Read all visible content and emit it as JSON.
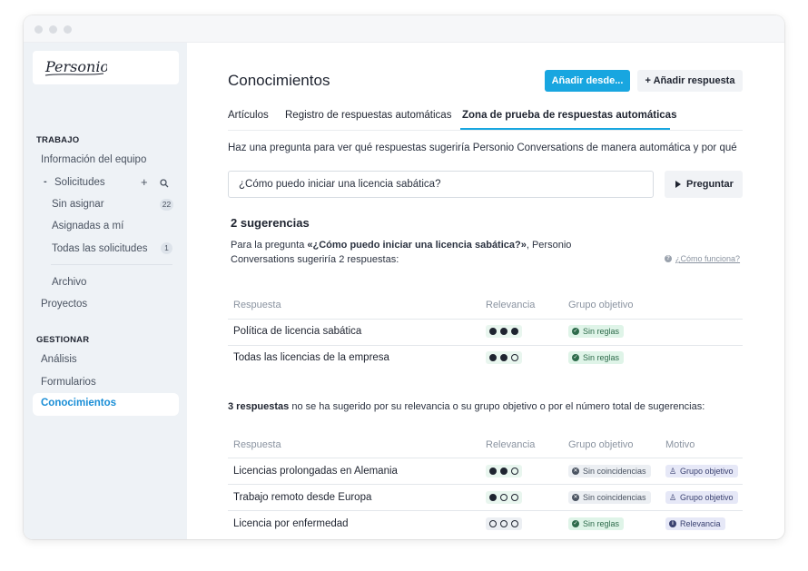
{
  "sidebar": {
    "logo_text": "Personio",
    "sections": [
      {
        "title": "TRABAJO"
      },
      {
        "title": "GESTIONAR"
      }
    ],
    "items": {
      "team_info": "Información del equipo",
      "requests": "Solicitudes",
      "unassigned": "Sin asignar",
      "unassigned_count": "22",
      "assigned_to_me": "Asignadas a mí",
      "all_requests": "Todas las solicitudes",
      "all_requests_count": "1",
      "archive": "Archivo",
      "projects": "Proyectos",
      "analysis": "Análisis",
      "forms": "Formularios",
      "knowledge": "Conocimientos"
    },
    "icons": {
      "collapse": "-",
      "add": "+",
      "search": "search-icon"
    }
  },
  "header": {
    "title": "Conocimientos",
    "add_from_label": "Añadir desde...",
    "add_answer_label": "+ Añadir respuesta"
  },
  "tabs": [
    {
      "label": "Artículos",
      "active": false
    },
    {
      "label": "Registro de respuestas automáticas",
      "active": false
    },
    {
      "label": "Zona de prueba de respuestas automáticas",
      "active": true
    }
  ],
  "playground": {
    "intro": "Haz una pregunta para ver qué respuestas sugeriría Personio Conversations de manera automática y por qué",
    "question_value": "¿Cómo puedo iniciar una licencia sabática?",
    "ask_label": "Preguntar"
  },
  "suggestions": {
    "title": "2 sugerencias",
    "desc_prefix": "Para la pregunta ",
    "desc_question": "«¿Cómo puedo iniciar una licencia sabática?»",
    "desc_suffix": ", Personio Conversations sugeriría 2 respuestas:",
    "help_link": "¿Cómo funciona?",
    "columns": {
      "answer": "Respuesta",
      "relevance": "Relevancia",
      "target_group": "Grupo objetivo"
    },
    "rows": [
      {
        "answer": "Política de licencia sabática",
        "relevance": 3,
        "target": "Sin reglas"
      },
      {
        "answer": "Todas las licencias de la empresa",
        "relevance": 2,
        "target": "Sin reglas"
      }
    ]
  },
  "not_suggested": {
    "count_bold": "3 respuestas",
    "text": " no se ha sugerido por su relevancia o su grupo objetivo o por el número total de sugerencias:",
    "columns": {
      "answer": "Respuesta",
      "relevance": "Relevancia",
      "target_group": "Grupo objetivo",
      "reason": "Motivo"
    },
    "rows": [
      {
        "answer": "Licencias prolongadas en Alemania",
        "relevance": 2,
        "target": "Sin coincidencias",
        "reason": "Grupo objetivo"
      },
      {
        "answer": "Trabajo remoto desde Europa",
        "relevance": 1,
        "target": "Sin coincidencias",
        "reason": "Grupo objetivo"
      },
      {
        "answer": "Licencia por enfermedad",
        "relevance": 0,
        "target": "Sin reglas",
        "reason": "Relevancia"
      }
    ]
  },
  "colors": {
    "accent": "#18a6e0",
    "active_nav": "#1a8ed6",
    "green_pill": "#dff4e8",
    "violet_pill": "#e6e8f7"
  }
}
